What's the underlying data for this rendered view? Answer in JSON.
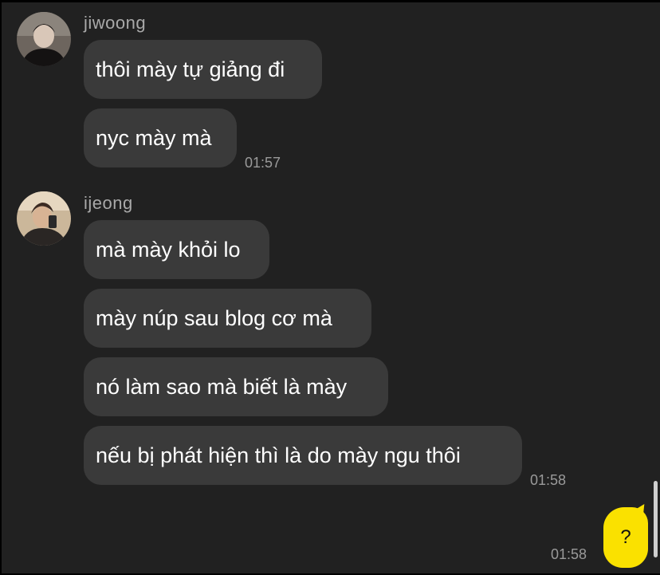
{
  "groups": [
    {
      "sender": "jiwoong",
      "messages": [
        "thôi mày tự giảng đi",
        "nyc mày mà"
      ],
      "time": "01:57"
    },
    {
      "sender": "ijeong",
      "messages": [
        "mà mày khỏi lo",
        "mày núp sau blog cơ mà",
        "nó làm sao mà biết là mày",
        "nếu bị phát hiện thì là do mày ngu thôi"
      ],
      "time": "01:58"
    }
  ],
  "outgoing": {
    "text": "?",
    "time": "01:58",
    "color": "#fae100"
  },
  "colors": {
    "background": "#212121",
    "bubble": "#3a3a3a"
  }
}
